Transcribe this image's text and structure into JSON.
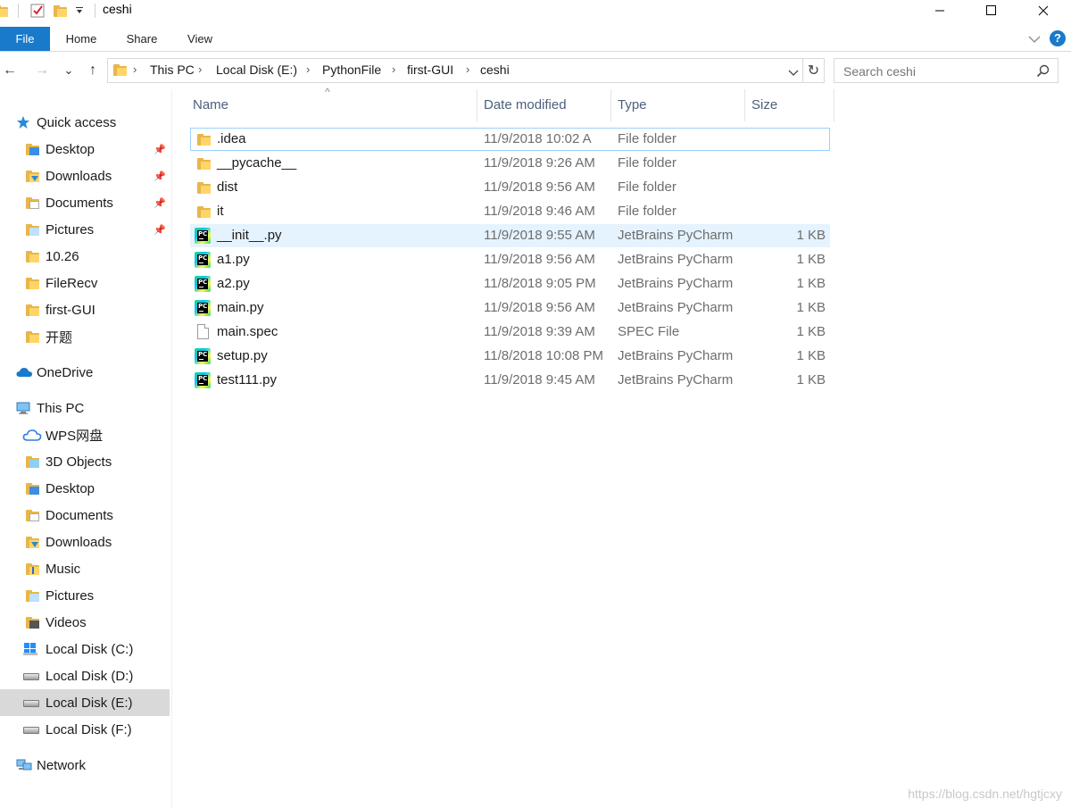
{
  "window": {
    "title": "ceshi",
    "quick_access_toolbar": [
      "folder-icon",
      "properties-check-icon",
      "new-folder-icon",
      "customize-dropdown-icon"
    ],
    "controls": [
      "minimize-icon",
      "maximize-icon",
      "close-icon"
    ]
  },
  "ribbon": {
    "tabs": [
      {
        "label": "File",
        "active": true
      },
      {
        "label": "Home"
      },
      {
        "label": "Share"
      },
      {
        "label": "View"
      }
    ],
    "right_icons": [
      "expand-ribbon-icon",
      "help-icon"
    ],
    "help_glyph": "?",
    "accent_color": "#1979ca"
  },
  "nav": {
    "back_glyph": "←",
    "forward_glyph": "→",
    "recent_glyph": "⌄",
    "up_glyph": "↑",
    "breadcrumb": [
      "This PC",
      "Local Disk (E:)",
      "PythonFile",
      "first-GUI",
      "ceshi"
    ],
    "refresh_glyph": "↻",
    "search_placeholder": "Search ceshi"
  },
  "sidebar": {
    "items": [
      {
        "label": "Quick access",
        "icon": "star-icon"
      },
      {
        "label": "Desktop",
        "icon": "desktop-folder-icon",
        "pinned": true
      },
      {
        "label": "Downloads",
        "icon": "downloads-folder-icon",
        "pinned": true
      },
      {
        "label": "Documents",
        "icon": "documents-folder-icon",
        "pinned": true
      },
      {
        "label": "Pictures",
        "icon": "pictures-folder-icon",
        "pinned": true
      },
      {
        "label": "10.26",
        "icon": "folder-icon"
      },
      {
        "label": "FileRecv",
        "icon": "folder-icon"
      },
      {
        "label": "first-GUI",
        "icon": "folder-icon"
      },
      {
        "label": "开题",
        "icon": "folder-icon"
      },
      {
        "label": "OneDrive",
        "icon": "cloud-icon"
      },
      {
        "label": "This PC",
        "icon": "computer-icon"
      },
      {
        "label": "WPS网盘",
        "icon": "wps-cloud-icon"
      },
      {
        "label": "3D Objects",
        "icon": "3d-objects-icon"
      },
      {
        "label": "Desktop",
        "icon": "desktop-folder-icon"
      },
      {
        "label": "Documents",
        "icon": "documents-folder-icon"
      },
      {
        "label": "Downloads",
        "icon": "downloads-folder-icon"
      },
      {
        "label": "Music",
        "icon": "music-folder-icon"
      },
      {
        "label": "Pictures",
        "icon": "pictures-folder-icon"
      },
      {
        "label": "Videos",
        "icon": "videos-folder-icon"
      },
      {
        "label": "Local Disk (C:)",
        "icon": "windows-drive-icon"
      },
      {
        "label": "Local Disk (D:)",
        "icon": "drive-icon"
      },
      {
        "label": "Local Disk (E:)",
        "icon": "drive-icon",
        "selected": true
      },
      {
        "label": "Local Disk (F:)",
        "icon": "drive-icon"
      },
      {
        "label": "Network",
        "icon": "network-icon"
      }
    ],
    "pin_glyph": "📌"
  },
  "list": {
    "columns": [
      "Name",
      "Date modified",
      "Type",
      "Size"
    ],
    "sort_glyph": "^",
    "rows": [
      {
        "name": ".idea",
        "date": "11/9/2018 10:02 A",
        "type": "File folder",
        "size": "",
        "icon": "folder-icon"
      },
      {
        "name": "__pycache__",
        "date": "11/9/2018 9:26 AM",
        "type": "File folder",
        "size": "",
        "icon": "folder-icon"
      },
      {
        "name": "dist",
        "date": "11/9/2018 9:56 AM",
        "type": "File folder",
        "size": "",
        "icon": "folder-icon"
      },
      {
        "name": "it",
        "date": "11/9/2018 9:46 AM",
        "type": "File folder",
        "size": "",
        "icon": "folder-icon"
      },
      {
        "name": "__init__.py",
        "date": "11/9/2018 9:55 AM",
        "type": "JetBrains PyCharm",
        "size": "1 KB",
        "icon": "pycharm-file-icon"
      },
      {
        "name": "a1.py",
        "date": "11/9/2018 9:56 AM",
        "type": "JetBrains PyCharm",
        "size": "1 KB",
        "icon": "pycharm-file-icon"
      },
      {
        "name": "a2.py",
        "date": "11/8/2018 9:05 PM",
        "type": "JetBrains PyCharm",
        "size": "1 KB",
        "icon": "pycharm-file-icon"
      },
      {
        "name": "main.py",
        "date": "11/9/2018 9:56 AM",
        "type": "JetBrains PyCharm",
        "size": "1 KB",
        "icon": "pycharm-file-icon"
      },
      {
        "name": "main.spec",
        "date": "11/9/2018 9:39 AM",
        "type": "SPEC File",
        "size": "1 KB",
        "icon": "blank-file-icon"
      },
      {
        "name": "setup.py",
        "date": "11/8/2018 10:08 PM",
        "type": "JetBrains PyCharm",
        "size": "1 KB",
        "icon": "pycharm-file-icon"
      },
      {
        "name": "test111.py",
        "date": "11/9/2018 9:45 AM",
        "type": "JetBrains PyCharm",
        "size": "1 KB",
        "icon": "pycharm-file-icon"
      }
    ],
    "pycharm_badge": "PC"
  },
  "watermark": "https://blog.csdn.net/hgtjcxy"
}
